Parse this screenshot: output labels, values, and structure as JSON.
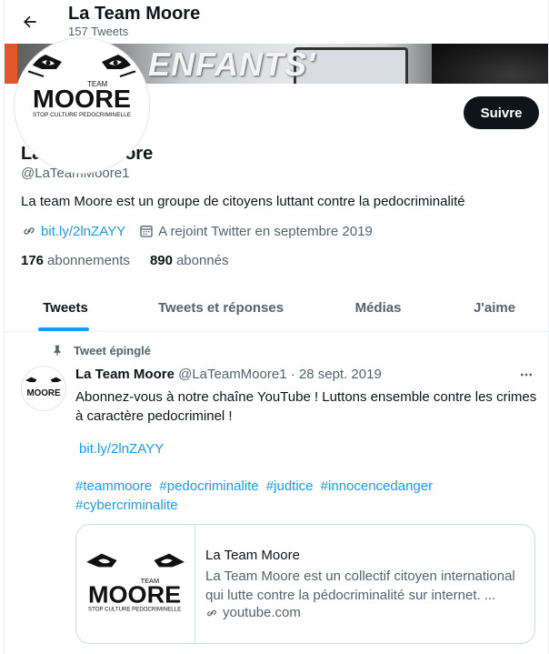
{
  "header": {
    "title": "La Team Moore",
    "tweet_count": "157 Tweets"
  },
  "banner": {
    "text": "ENFANTS'"
  },
  "profile": {
    "follow_label": "Suivre",
    "name": "La Team Moore",
    "handle": "@LaTeamMoore1",
    "bio": "La team Moore est un groupe de citoyens luttant contre la pedocriminalité",
    "link": "bit.ly/2lnZAYY",
    "joined": "A rejoint Twitter en septembre 2019",
    "following_count": "176",
    "following_label": "abonnements",
    "followers_count": "890",
    "followers_label": "abonnés"
  },
  "logo": {
    "team": "TEAM",
    "moore": "MOORE",
    "tagline": "STOP CULTURE PEDOCRIMINELLE"
  },
  "tabs": [
    {
      "label": "Tweets",
      "active": true
    },
    {
      "label": "Tweets et réponses",
      "active": false
    },
    {
      "label": "Médias",
      "active": false
    },
    {
      "label": "J'aime",
      "active": false
    }
  ],
  "tweet": {
    "pinned_label": "Tweet épinglé",
    "author": "La Team Moore",
    "handle": "@LaTeamMoore1",
    "separator": "·",
    "date": "28 sept. 2019",
    "text": "Abonnez-vous à notre chaîne YouTube ! Luttons ensemble contre les crimes à caractère pedocriminel !",
    "link": "bit.ly/2lnZAYY",
    "hashtags": [
      "#teammoore",
      "#pedocriminalite",
      "#judtice",
      "#innocencedanger",
      "#cybercriminalite"
    ],
    "card": {
      "title": "La Team Moore",
      "description": "La Team Moore est un collectif citoyen international qui lutte contre la pédocriminalité sur internet. ...",
      "domain": "youtube.com"
    }
  },
  "colors": {
    "accent": "#1d9bf0",
    "text": "#0f1419",
    "muted": "#536471",
    "button": "#0f1419"
  },
  "icons": [
    "back-arrow-icon",
    "link-icon",
    "calendar-icon",
    "pin-icon",
    "more-icon"
  ]
}
